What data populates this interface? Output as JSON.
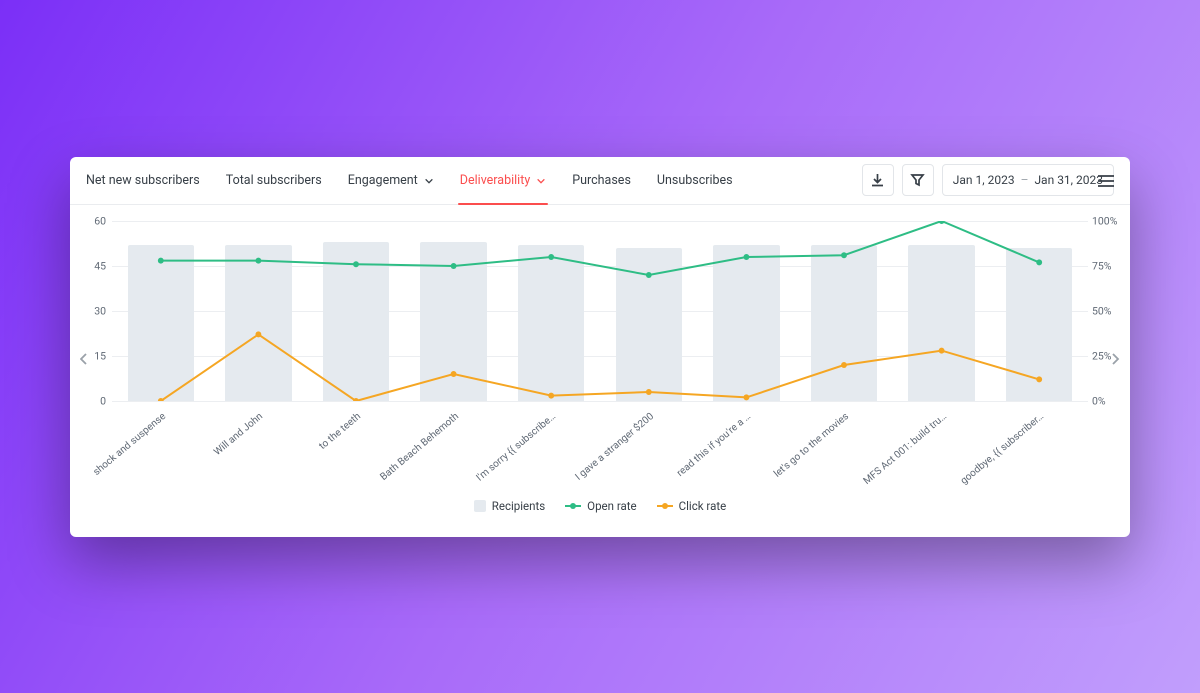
{
  "tabs": {
    "net_new": "Net new subscribers",
    "total": "Total subscribers",
    "engagement": "Engagement",
    "deliverability": "Deliverability",
    "purchases": "Purchases",
    "unsubscribes": "Unsubscribes"
  },
  "date_range": {
    "start": "Jan 1, 2023",
    "end": "Jan 31, 2023"
  },
  "icons": {
    "download": "download-icon",
    "filter": "filter-icon",
    "menu": "menu-icon",
    "chevron_down": "chevron-down-icon",
    "chevron_left": "chevron-left-icon",
    "chevron_right": "chevron-right-icon"
  },
  "legend": {
    "recipients": "Recipients",
    "open_rate": "Open rate",
    "click_rate": "Click rate"
  },
  "chart_data": {
    "type": "combo",
    "categories": [
      "shock and suspense",
      "Will and John",
      "to the teeth",
      "Bath Beach Behemoth",
      "I'm sorry {{ subscribe…",
      "I gave a stranger $200",
      "read this if you're a …",
      "let's go to the movies",
      "MFS Act 001: build tru…",
      "goodbye, {{ subscriber…"
    ],
    "series": [
      {
        "name": "Recipients",
        "type": "bar",
        "axis": "left",
        "values": [
          52,
          52,
          53,
          53,
          52,
          51,
          52,
          52,
          52,
          51
        ]
      },
      {
        "name": "Open rate",
        "type": "line",
        "axis": "right",
        "values": [
          78,
          78,
          76,
          75,
          80,
          70,
          80,
          81,
          100,
          77
        ]
      },
      {
        "name": "Click rate",
        "type": "line",
        "axis": "right",
        "values": [
          0,
          37,
          0,
          15,
          3,
          5,
          2,
          20,
          28,
          12
        ]
      }
    ],
    "y_left": {
      "min": 0,
      "max": 60,
      "ticks": [
        0,
        15,
        30,
        45,
        60
      ]
    },
    "y_right": {
      "min": 0,
      "max": 100,
      "ticks": [
        0,
        25,
        50,
        75,
        100
      ],
      "suffix": "%"
    },
    "colors": {
      "Recipients": "#e5eaef",
      "Open rate": "#2ebd85",
      "Click rate": "#f5a623"
    }
  }
}
